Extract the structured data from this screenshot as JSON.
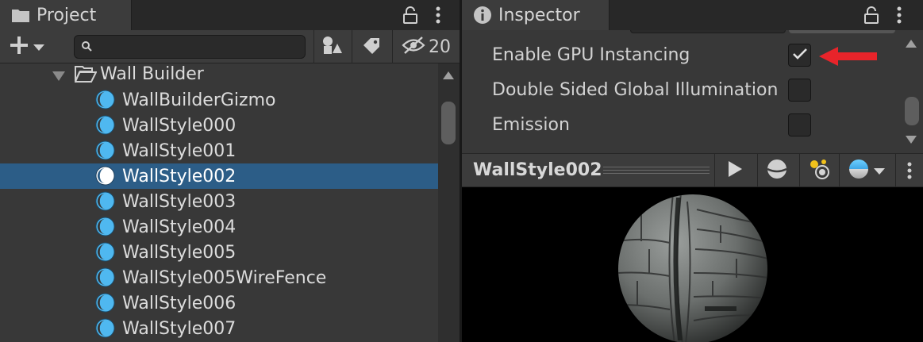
{
  "project": {
    "tab_label": "Project",
    "hidden_count": "20",
    "search_placeholder": "",
    "folder": "Wall Builder",
    "items": [
      {
        "label": "WallBuilderGizmo",
        "selected": false
      },
      {
        "label": "WallStyle000",
        "selected": false
      },
      {
        "label": "WallStyle001",
        "selected": false
      },
      {
        "label": "WallStyle002",
        "selected": true
      },
      {
        "label": "WallStyle003",
        "selected": false
      },
      {
        "label": "WallStyle004",
        "selected": false
      },
      {
        "label": "WallStyle005",
        "selected": false
      },
      {
        "label": "WallStyle005WireFence",
        "selected": false
      },
      {
        "label": "WallStyle006",
        "selected": false
      },
      {
        "label": "WallStyle007",
        "selected": false
      }
    ]
  },
  "inspector": {
    "tab_label": "Inspector",
    "properties": [
      {
        "label": "Enable GPU Instancing",
        "checked": true
      },
      {
        "label": "Double Sided Global Illumination",
        "checked": false
      },
      {
        "label": "Emission",
        "checked": false
      }
    ],
    "preview_title": "WallStyle002"
  },
  "colors": {
    "selection": "#2c5d87",
    "material_icon": "#4fb8f0",
    "annotation_arrow": "#e8242a",
    "panel_bg": "#383838"
  },
  "icons": {
    "project_tab": "folder-icon",
    "inspector_tab": "info-icon",
    "lock": "lock-icon",
    "menu": "kebab-menu-icon",
    "add": "plus-icon",
    "search": "search-icon",
    "filter_type": "shapes-icon",
    "filter_label": "tag-icon",
    "hidden": "eye-slash-icon",
    "play": "play-icon",
    "preview_mesh": "sphere-icon",
    "lights": "lights-icon",
    "preview_bg": "sky-sphere-icon"
  }
}
